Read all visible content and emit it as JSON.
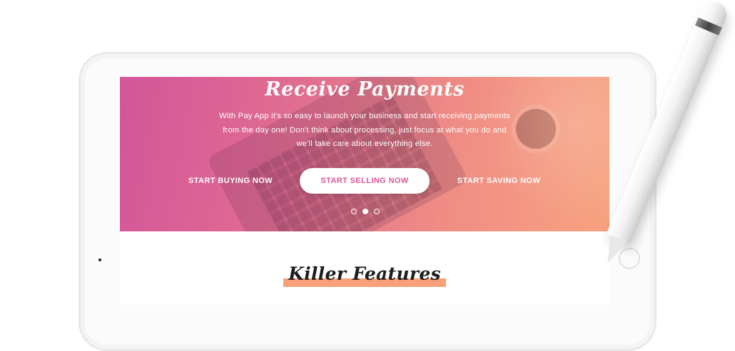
{
  "hero": {
    "title": "Receive Payments",
    "description": "With Pay App it's so easy to launch your business and start receiving payments from the day one! Don't think about processing, just focus at what you do and we'll take care about everything else.",
    "buttons": {
      "left": "START BUYING NOW",
      "main": "START SELLING NOW",
      "right": "START SAVING NOW"
    },
    "carousel": {
      "count": 3,
      "active_index": 1
    }
  },
  "features": {
    "title": "Killer Features"
  },
  "colors": {
    "gradient_start": "#d3559a",
    "gradient_end": "#f7a27f",
    "accent": "#d9559a",
    "highlight": "#f7a07a"
  },
  "icons": [
    "stylus-pencil-icon",
    "home-button-icon",
    "camera-icon"
  ]
}
